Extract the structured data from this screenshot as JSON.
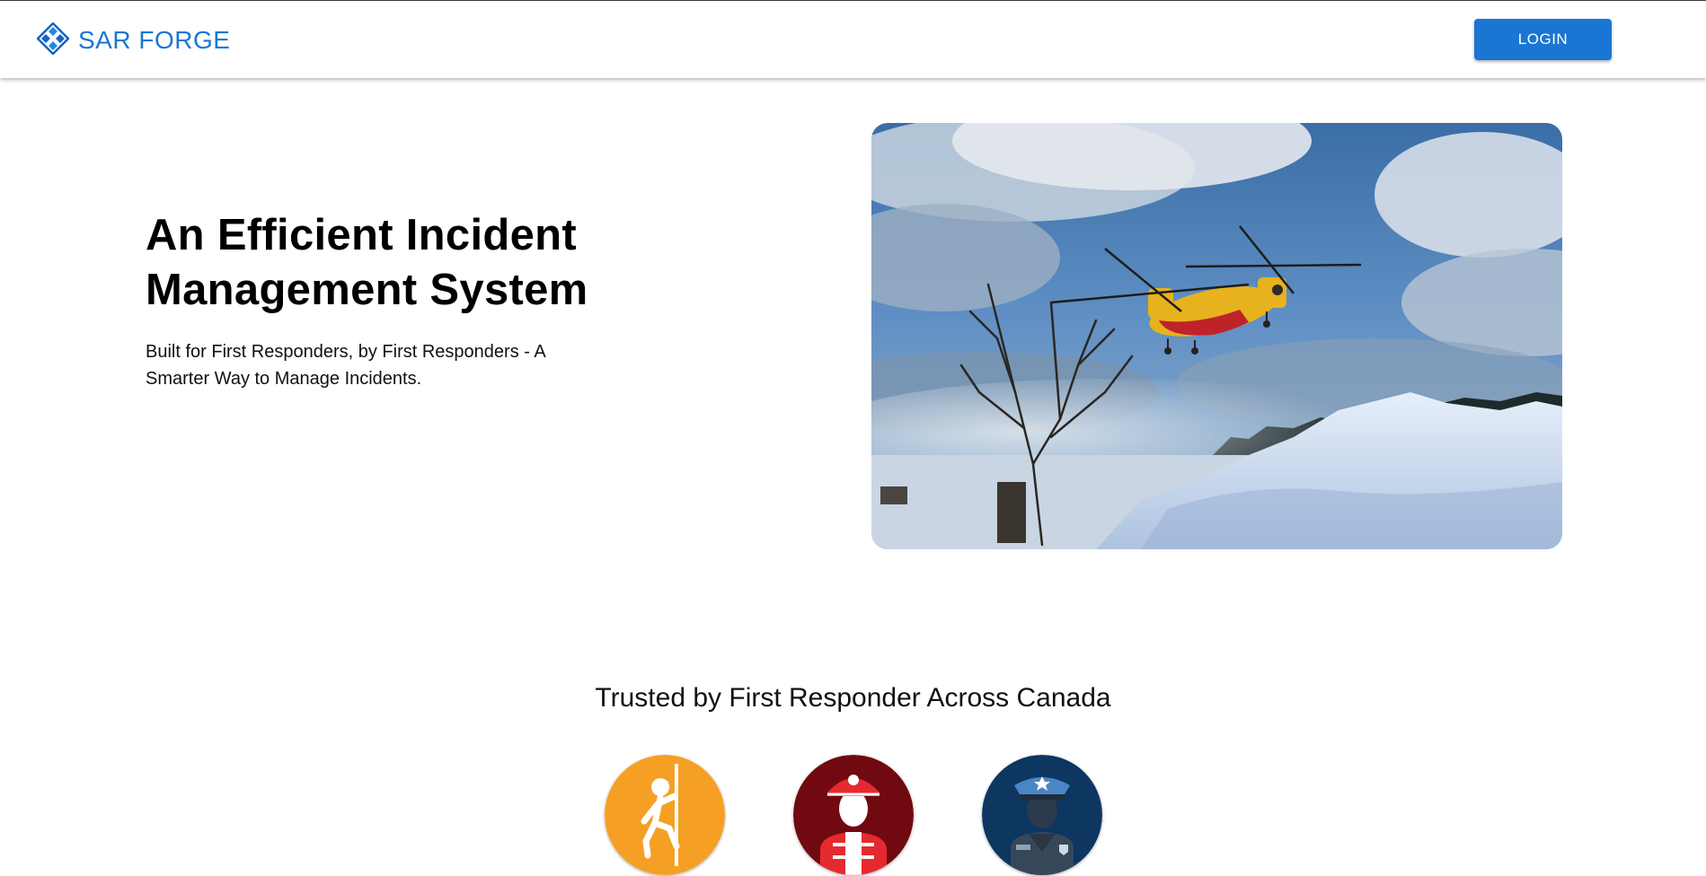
{
  "header": {
    "brand_name": "SAR FORGE",
    "logo_icon": "diamond-grid-icon",
    "login_label": "LOGIN"
  },
  "hero": {
    "title_line1": "An Efficient Incident",
    "title_line2": "Management System",
    "subtitle_line1": "Built for First Responders, by First Responders - A",
    "subtitle_line2": "Smarter Way to Manage Incidents.",
    "image": "rescue-helicopter-over-snow-photo"
  },
  "trusted": {
    "heading": "Trusted by First Responder Across Canada",
    "badges": [
      {
        "icon": "rope-rescue-climber-icon",
        "color": "#f5a024"
      },
      {
        "icon": "firefighter-icon",
        "color": "#700a10"
      },
      {
        "icon": "police-officer-icon",
        "color": "#0d3661"
      }
    ]
  },
  "colors": {
    "accent": "#1976d2"
  }
}
